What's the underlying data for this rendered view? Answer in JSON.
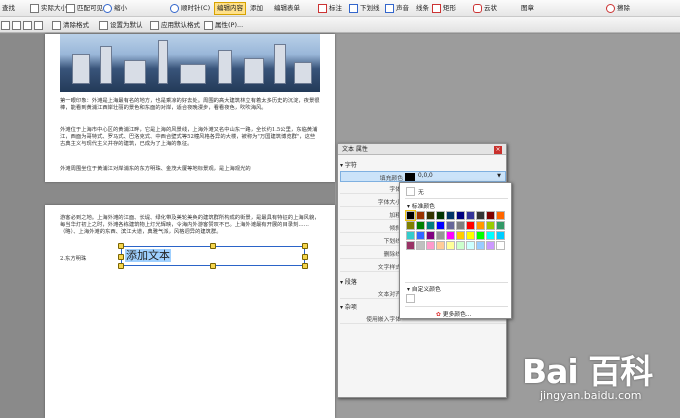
{
  "toolbar_top": [
    {
      "name": "arrange-button",
      "label": "查找"
    },
    {
      "name": "actual-size-button",
      "label": "实际大小"
    },
    {
      "name": "fit-visible-button",
      "label": "匹配可见"
    },
    {
      "name": "zoom-out-button",
      "label": "缩小"
    },
    {
      "name": "rotate-cw-button",
      "label": "顺时针(C)"
    },
    {
      "name": "edit-content-tab",
      "label": "编辑内容"
    },
    {
      "name": "add-button",
      "label": "添加"
    },
    {
      "name": "edit-form-button",
      "label": "编辑表单"
    },
    {
      "name": "annotation-button",
      "label": "标注"
    },
    {
      "name": "underline-button",
      "label": "下划线"
    },
    {
      "name": "sound-button",
      "label": "声音"
    },
    {
      "name": "lines-button",
      "label": "线条"
    },
    {
      "name": "rectangle-button",
      "label": "矩形"
    },
    {
      "name": "cloud-button",
      "label": "云状"
    },
    {
      "name": "chart-button",
      "label": "图章"
    },
    {
      "name": "erase-button",
      "label": "擦除"
    }
  ],
  "toolbar_bottom": [
    {
      "name": "clear-format-button",
      "label": "清除格式"
    },
    {
      "name": "set-default-button",
      "label": "设置为默认"
    },
    {
      "name": "apply-default-format-button",
      "label": "应用默认格式"
    },
    {
      "name": "properties-button",
      "label": "属性(P)..."
    }
  ],
  "doc": {
    "p1": "第一眼印象：外滩是上海最有名的地方，也是乘凉的好去处。周围的高大建筑林立有着太多历史的沉淀，夜景很棒，能看到黄浦江西岸壮丽的景色和东面的对岸，适合夜晚漫步，看看夜色，吹吹海风。",
    "p2": "外滩位于上海市中心区的黄浦江畔，它是上海的风景线，上海外滩又名中山东一路，全长约1.5公里，东临黄浦江，西面为哥特式、罗马式、巴洛克式、中西合壁式等52幢风格各异的大楼，被称为\"万国建筑博览群\"，这些古典主义与现代主义并存的建筑，已成为了上海的象征。",
    "p3": "外滩周围坐位于黄浦江对岸浦东的东方明珠、金茂大厦等地标景观，是上海观光的",
    "p4": "游客必到之地。上海外滩的江面、长堤、绿化带及美轮美奂的建筑群所构成的街景，是最具有特征的上海风貌，每当华灯初上之时，外滩各栋建筑物上灯光辉映，令海内外游客赞叹不已。上海外滩最有开展的目录刻……（略）、上海外滩的东西、滨江大道，典雅气派，风格迥异的建筑群。",
    "p5": "2.东方明珠",
    "editing_text": "添加文本"
  },
  "panel": {
    "title": "文本 属性",
    "close": "×",
    "section_char": "字符",
    "fill_label": "填充颜色",
    "fill_value": "0,0,0",
    "labels": [
      "字体",
      "字体大小",
      "加粗",
      "倾斜",
      "下划线",
      "删除线",
      "文字样式"
    ],
    "section_para": "段落",
    "para_labels": [
      "文本对齐"
    ],
    "section_misc": "杂项",
    "misc_labels": [
      "使用嵌入字体"
    ]
  },
  "palette": {
    "none_label": "无",
    "standard_label": "标准颜色",
    "custom_label": "自定义颜色",
    "more_label": "更多颜色...",
    "standard_colors": [
      "#000000",
      "#993300",
      "#333300",
      "#003300",
      "#003366",
      "#000080",
      "#333399",
      "#333333",
      "#800000",
      "#ff6600",
      "#808000",
      "#008000",
      "#008080",
      "#0000ff",
      "#666699",
      "#808080",
      "#ff0000",
      "#ff9900",
      "#99cc00",
      "#339966",
      "#33cccc",
      "#3366ff",
      "#800080",
      "#969696",
      "#ff00ff",
      "#ffcc00",
      "#ffff00",
      "#00ff00",
      "#00ffff",
      "#00ccff",
      "#993366",
      "#c0c0c0",
      "#ff99cc",
      "#ffcc99",
      "#ffff99",
      "#ccffcc",
      "#ccffff",
      "#99ccff",
      "#cc99ff",
      "#ffffff"
    ]
  },
  "watermark": {
    "brand": "Bai  百科",
    "sub": "jingyan.baidu.com"
  }
}
